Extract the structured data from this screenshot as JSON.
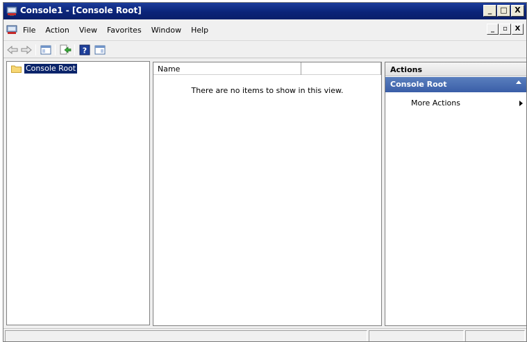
{
  "window": {
    "title": "Console1 - [Console Root]",
    "caption_buttons": [
      "_",
      "□",
      "X"
    ]
  },
  "menubar": {
    "items": [
      "File",
      "Action",
      "View",
      "Favorites",
      "Window",
      "Help"
    ],
    "mdi_buttons": [
      "_",
      "▫",
      "X"
    ]
  },
  "toolbar": {
    "buttons": [
      "back-icon",
      "forward-icon",
      "show-hide-console-tree-icon",
      "export-list-icon",
      "help-icon",
      "show-hide-action-pane-icon"
    ]
  },
  "tree": {
    "root_label": "Console Root"
  },
  "list": {
    "columns": [
      "Name",
      ""
    ],
    "empty_message": "There are no items to show in this view."
  },
  "actions": {
    "header": "Actions",
    "group": "Console Root",
    "items": [
      "More Actions"
    ]
  },
  "colors": {
    "titlebar": "#0b2479",
    "selection": "#0a246a",
    "actions_group": "#4a6fb3"
  }
}
